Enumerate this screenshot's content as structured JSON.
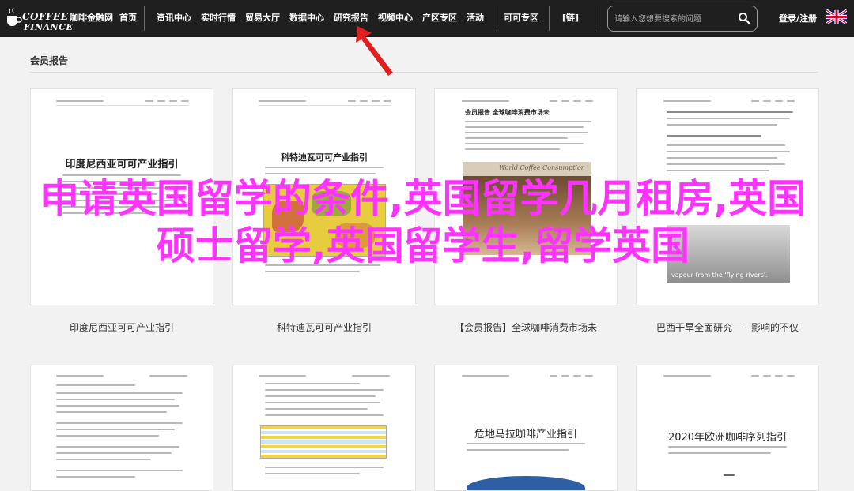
{
  "nav": {
    "logo_line1": "COFFEE",
    "logo_line2": "FINANCE",
    "items": [
      "咖啡金融网",
      "首页",
      "资讯中心",
      "实时行情",
      "贸易大厅",
      "数据中心",
      "研究报告",
      "视频中心",
      "产区专区",
      "活动",
      "可可专区",
      "[链]"
    ],
    "search_placeholder": "请输入您想要搜索的问题",
    "login": "登录/注册",
    "lang_flag": "uk-flag-icon"
  },
  "section": {
    "title": "会员报告"
  },
  "overlay_title": "申请英国留学的条件,英国留学几月租房,英国硕士留学,英国留学生,留学英国",
  "cards_row1": [
    {
      "doc_title": "印度尼西亚可可产业指引",
      "caption": "印度尼西亚可可产业指引"
    },
    {
      "doc_title": "科特迪瓦可可产业指引",
      "caption": "科特迪瓦可可产业指引"
    },
    {
      "doc_header": "会员报告 全球咖啡消费市场未",
      "banner": "World Coffee Consumption",
      "caption": "【会员报告】全球咖啡消费市场未"
    },
    {
      "banner": "vapour from the 'flying rivers'.",
      "caption": "巴西干旱全面研究——影响的不仅"
    }
  ],
  "cards_row2": [
    {
      "doc_title": ""
    },
    {
      "doc_title": ""
    },
    {
      "doc_title": "危地马拉咖啡产业指引"
    },
    {
      "doc_title": "2020年欧洲咖啡序列指引"
    }
  ],
  "colors": {
    "nav_bg": "#1f1f1f",
    "overlay": "#ff33ff",
    "arrow": "#e02020"
  }
}
